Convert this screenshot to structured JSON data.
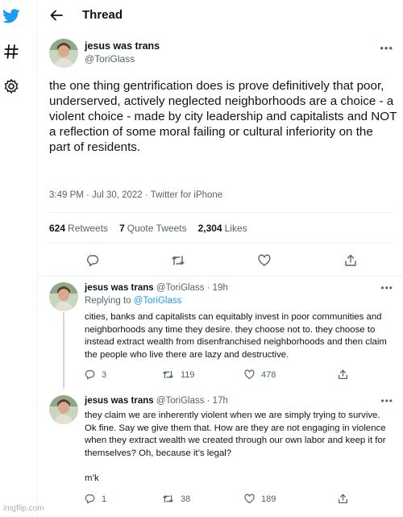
{
  "colors": {
    "brand": "#1d9bf0",
    "muted": "#536471",
    "text": "#0f1419",
    "divider": "#eff3f4"
  },
  "rail": {
    "icons": [
      "twitter-bird-icon",
      "hashtag-icon",
      "gear-icon"
    ]
  },
  "header": {
    "title": "Thread"
  },
  "main_tweet": {
    "display_name": "jesus was trans",
    "handle": "@ToriGlass",
    "text": "the one thing gentrification does is prove definitively that poor, underserved, actively neglected neighborhoods are a choice - a violent choice - made by city leadership and capitalists and NOT a reflection of some moral failing or cultural inferiority on the part of residents.",
    "meta": "3:49 PM · Jul 30, 2022 · Twitter for iPhone",
    "retweets_count": "624",
    "retweets_label": "Retweets",
    "quotes_count": "7",
    "quotes_label": "Quote Tweets",
    "likes_count": "2,304",
    "likes_label": "Likes"
  },
  "replies": [
    {
      "display_name": "jesus was trans",
      "handle_time": "@ToriGlass · 19h",
      "replying_prefix": "Replying to",
      "replying_handle": "@ToriGlass",
      "text": "cities, banks and capitalists can equitably invest in poor communities and neighborhoods any time they desire. they choose not to. they choose to instead extract wealth from disenfranchised neighborhoods and then claim the people who live there are lazy and destructive.",
      "reply_count": "3",
      "retweet_count": "119",
      "like_count": "478"
    },
    {
      "display_name": "jesus was trans",
      "handle_time": "@ToriGlass · 17h",
      "text": "they claim we are inherently violent when we are simply trying to survive. Ok fine. Say we give them that. How are they are not engaging in violence when they extract wealth we created through our own labor and keep it for themselves? Oh, because it’s legal?\n\nm’k",
      "reply_count": "1",
      "retweet_count": "38",
      "like_count": "189"
    }
  ],
  "watermark": "imgflip.com"
}
